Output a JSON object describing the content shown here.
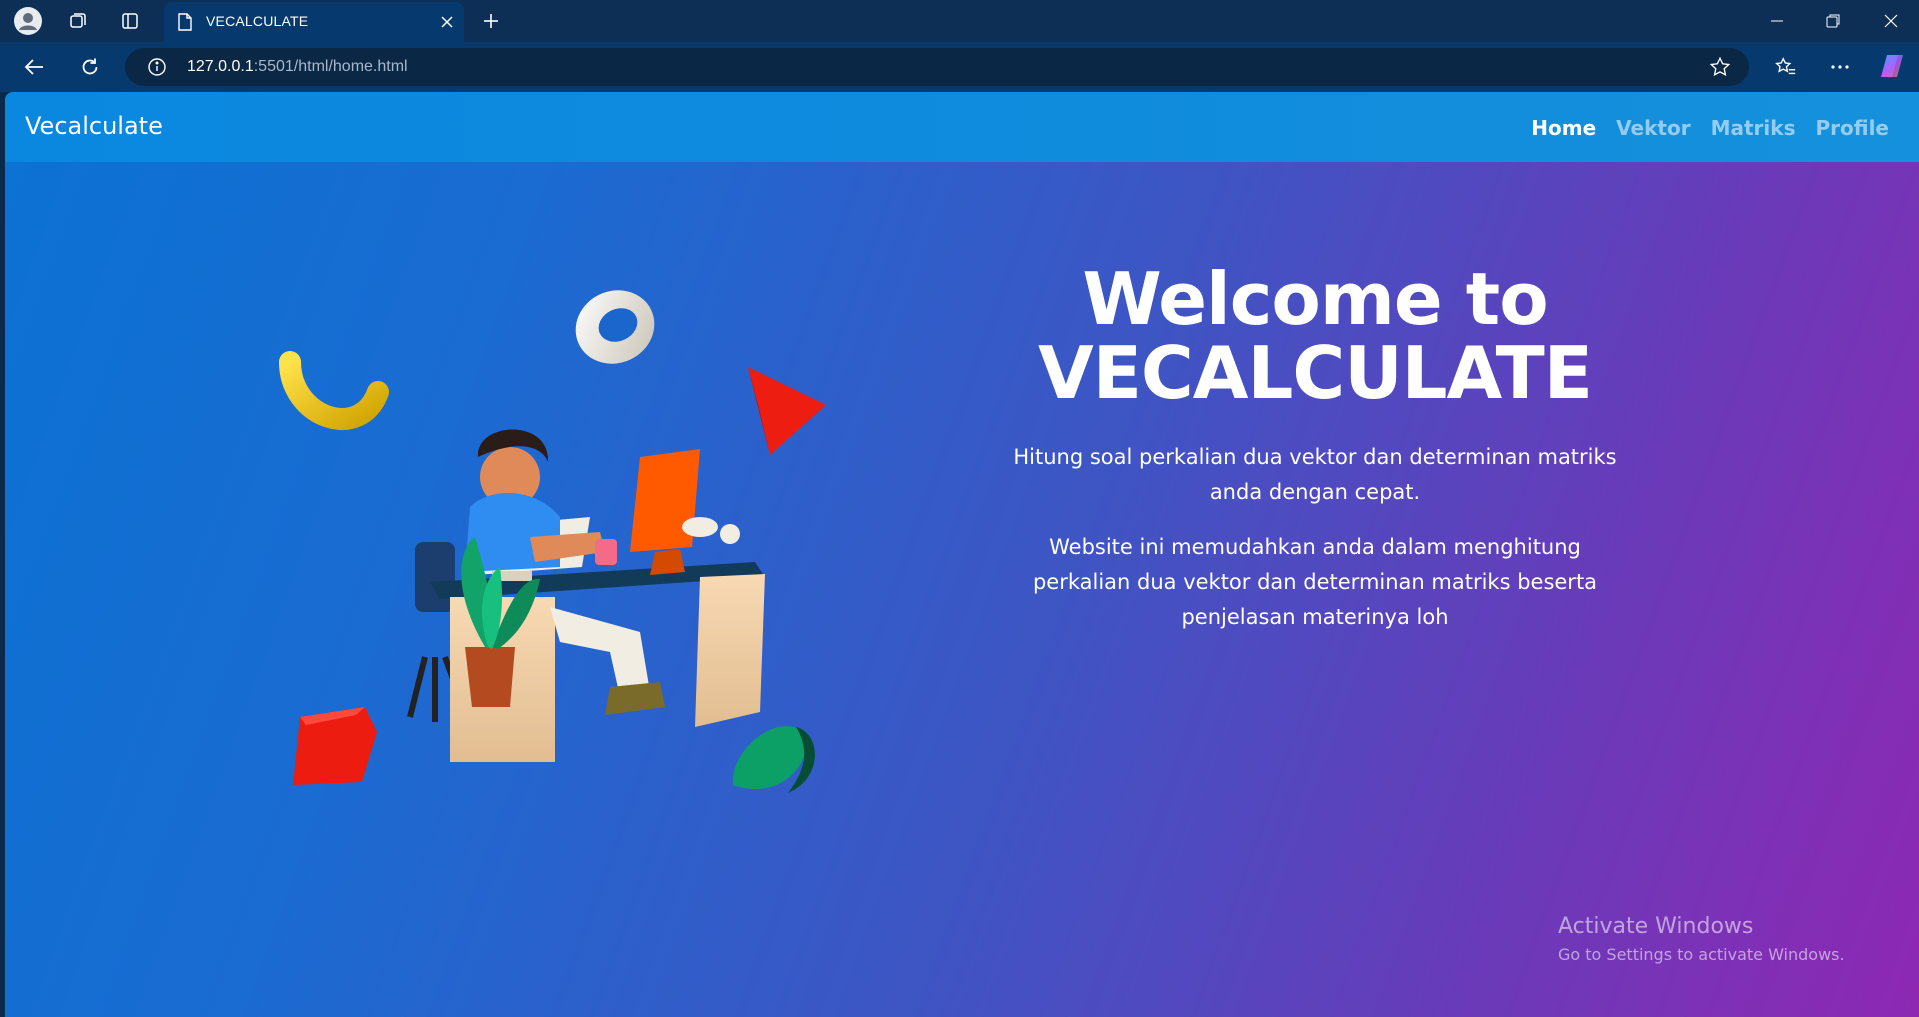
{
  "browser": {
    "tab_title": "VECALCULATE",
    "url_host": "127.0.0.1",
    "url_rest": ":5501/html/home.html"
  },
  "navbar": {
    "brand": "Vecalculate",
    "links": [
      "Home",
      "Vektor",
      "Matriks",
      "Profile"
    ],
    "active": "Home"
  },
  "hero": {
    "title_line1": "Welcome to",
    "title_line2": "VECALCULATE",
    "subtitle": "Hitung soal perkalian dua vektor dan determinan matriks anda dengan cepat.",
    "description": "Website ini memudahkan anda dalam menghitung perkalian dua vektor dan determinan matriks beserta penjelasan materinya loh"
  },
  "watermark": {
    "title": "Activate Windows",
    "subtitle": "Go to Settings to activate Windows."
  },
  "icons": [
    "profile-icon",
    "workspaces-icon",
    "tab-actions-icon",
    "page-icon",
    "close-icon",
    "new-tab-icon",
    "minimize-icon",
    "restore-icon",
    "window-close-icon",
    "back-icon",
    "refresh-icon",
    "info-icon",
    "star-icon",
    "favorites-icon",
    "more-icon",
    "copilot-icon"
  ],
  "colors": {
    "navbar": "#0a87df",
    "gradient_start": "#0b72d3",
    "gradient_end": "#8e28b3"
  }
}
